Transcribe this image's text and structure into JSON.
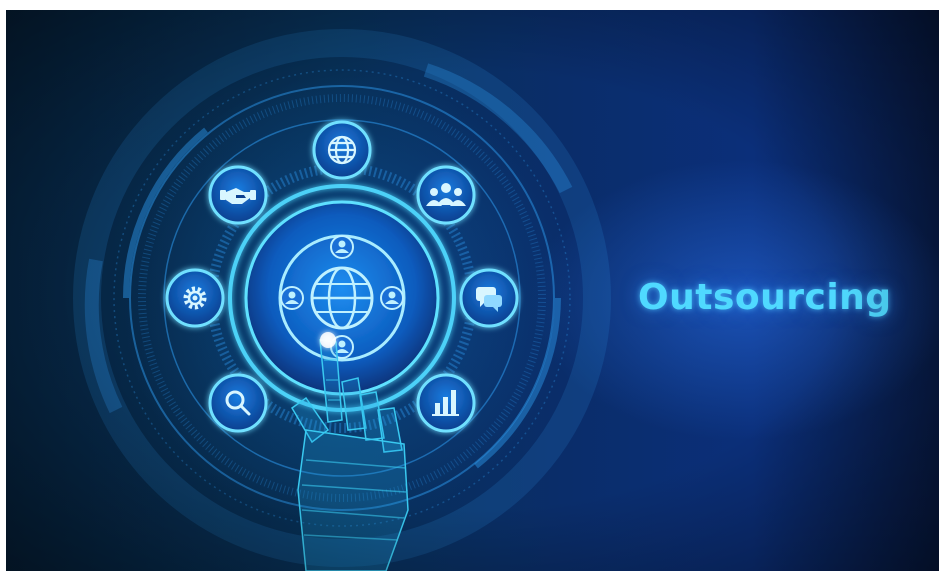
{
  "headline": "Outsourcing",
  "colors": {
    "background_dark": "#06233f",
    "background_blue": "#0b2f7a",
    "glow_cyan": "#4fd9ff",
    "icon_circle": "#0a4fa8",
    "text_cyan": "#4fd9ff"
  },
  "icons": [
    "globe-icon",
    "team-icon",
    "chat-icon",
    "bar-chart-icon",
    "magnifier-icon",
    "gear-icon",
    "handshake-icon",
    "global-network-icon"
  ]
}
